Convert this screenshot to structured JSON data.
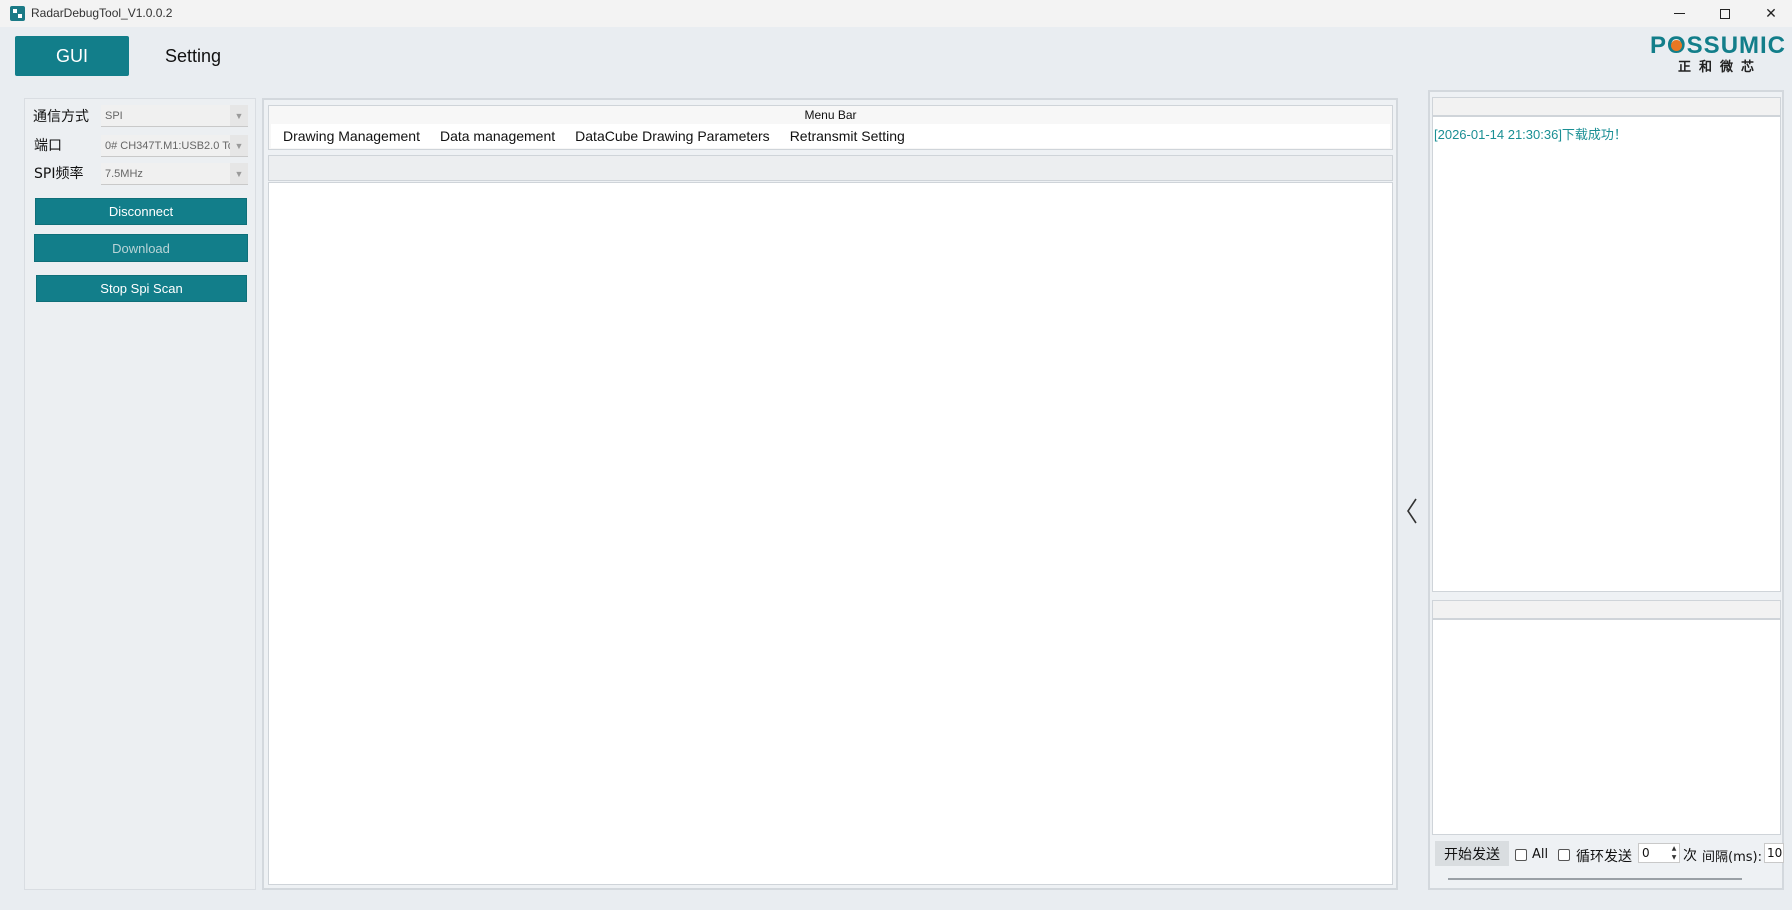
{
  "window": {
    "title": "RadarDebugTool_V1.0.0.2"
  },
  "nav": {
    "tabs": [
      {
        "label": "GUI",
        "active": true
      },
      {
        "label": "Setting",
        "active": false
      }
    ]
  },
  "logo": {
    "text": "POSSUMIC",
    "subtext": "正和微芯",
    "color": "#127e8a",
    "dot_color": "#e87722"
  },
  "left_panel": {
    "fields": [
      {
        "label": "通信方式",
        "value": "SPI"
      },
      {
        "label": "端口",
        "value": "0# CH347T.M1:USB2.0 To"
      },
      {
        "label": "SPI频率",
        "value": "7.5MHz"
      }
    ],
    "buttons": {
      "disconnect": "Disconnect",
      "download": "Download",
      "stop_scan": "Stop Spi Scan"
    }
  },
  "center": {
    "menu_bar_title": "Menu Bar",
    "menu_items": [
      "Drawing Management",
      "Data management",
      "DataCube Drawing Parameters",
      "Retransmit Setting"
    ]
  },
  "right_panel": {
    "log_lines": [
      "[2026-01-14 21:30:36]下载成功！"
    ],
    "send_controls": {
      "send_button": "开始发送",
      "all_label": "All",
      "all_checked": false,
      "loop_label": "循环发送",
      "loop_checked": false,
      "count_value": "0",
      "count_unit": "次",
      "interval_label": "间隔(ms):",
      "interval_value": "10"
    }
  },
  "colors": {
    "accent": "#127e8a",
    "log_text": "#1a8f94"
  }
}
